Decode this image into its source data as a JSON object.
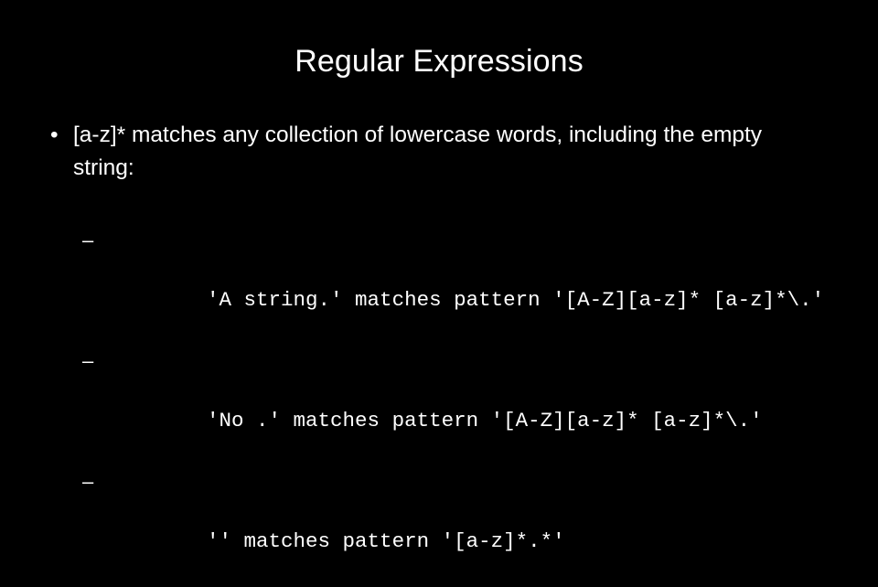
{
  "slide": {
    "title": "Regular Expressions",
    "background_color": "#000000",
    "text_color": "#ffffff",
    "bullets": [
      {
        "marker": "•",
        "text": "[a-z]* matches any collection of lowercase words, including the empty string:"
      }
    ],
    "code_lines": [
      {
        "marker": "–",
        "text": "'A string.' matches pattern '[A-Z][a-z]* [a-z]*\\.'"
      },
      {
        "marker": "–",
        "text": "'No .' matches pattern '[A-Z][a-z]* [a-z]*\\.'"
      },
      {
        "marker": "–",
        "text": "'' matches pattern '[a-z]*.*'"
      }
    ]
  }
}
